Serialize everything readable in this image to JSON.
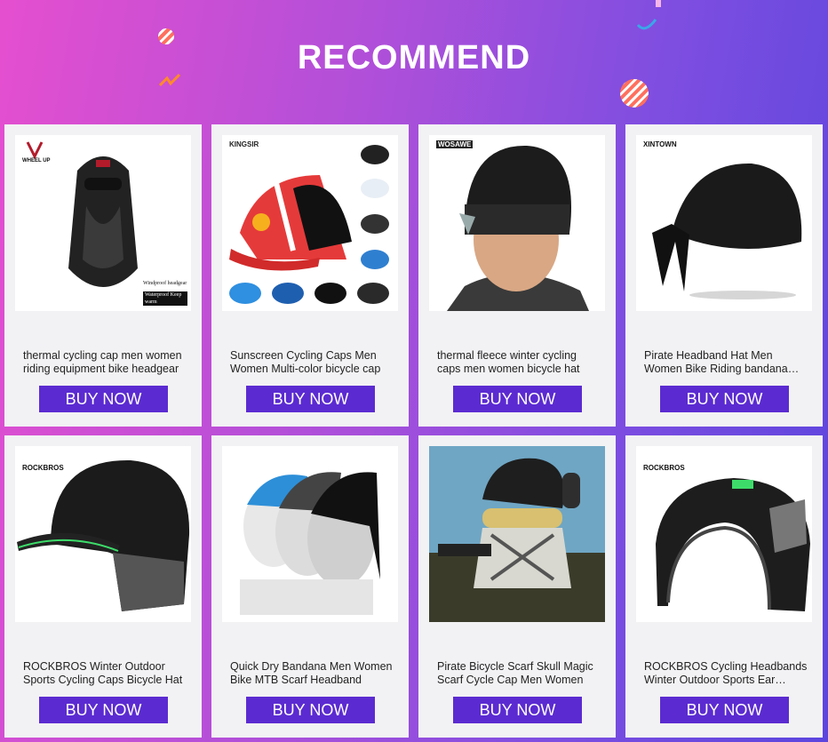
{
  "header": {
    "title": "RECOMMEND"
  },
  "products": [
    {
      "brand": "WHEEL UP",
      "title": "thermal cycling cap men women riding equipment bike headgear",
      "cta": "BUY NOW",
      "image": "balaclava-image",
      "extra1": "Windproof headgear",
      "extra2": "Waterproof Keep warm"
    },
    {
      "brand": "KINGSIR",
      "title": "Sunscreen Cycling Caps Men Women Multi-color bicycle cap",
      "cta": "BUY NOW",
      "image": "cycling-caps-image"
    },
    {
      "brand": "WOSAWE",
      "title": "thermal fleece winter cycling caps men women bicycle hat",
      "cta": "BUY NOW",
      "image": "fleece-beanie-image"
    },
    {
      "brand": "XINTOWN",
      "title": "Pirate Headband Hat Men Women Bike Riding bandana scarf",
      "cta": "BUY NOW",
      "image": "pirate-bandana-image"
    },
    {
      "brand": "ROCKBROS",
      "title": "ROCKBROS Winter Outdoor Sports Cycling Caps Bicycle Hat",
      "cta": "BUY NOW",
      "image": "winter-cap-image"
    },
    {
      "brand": "",
      "title": "Quick Dry Bandana Men Women Bike MTB Scarf Headband",
      "cta": "BUY NOW",
      "image": "quick-dry-bandana-image"
    },
    {
      "brand": "",
      "title": "Pirate Bicycle Scarf Skull Magic Scarf Cycle Cap Men Women",
      "cta": "BUY NOW",
      "image": "skull-scarf-image"
    },
    {
      "brand": "ROCKBROS",
      "title": "ROCKBROS Cycling Headbands Winter Outdoor Sports Ear Warmer",
      "cta": "BUY NOW",
      "image": "ear-warmer-headband-image"
    }
  ],
  "colors": {
    "button": "#5b2bd1",
    "card": "#f2f2f4",
    "accent_green": "#3ddc6a"
  }
}
